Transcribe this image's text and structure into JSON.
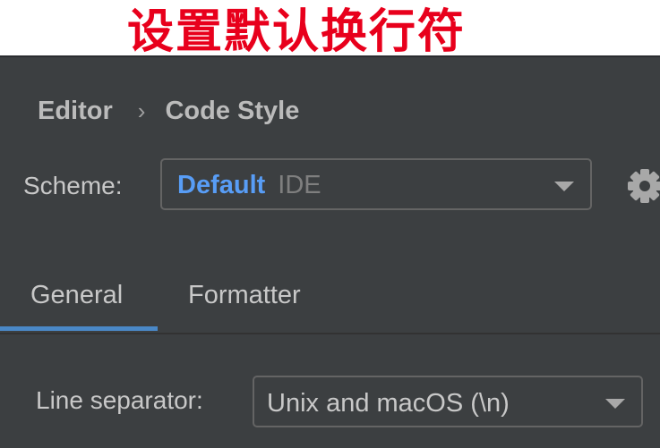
{
  "banner": {
    "title": "设置默认换行符"
  },
  "breadcrumb": {
    "items": [
      "Editor",
      "Code Style"
    ],
    "separator": "›"
  },
  "scheme": {
    "label": "Scheme:",
    "value_name": "Default",
    "value_type": "IDE",
    "settings_icon": "gear-icon"
  },
  "tabs": {
    "items": [
      "General",
      "Formatter"
    ],
    "selected": "General"
  },
  "line_separator": {
    "label": "Line separator:",
    "value": "Unix and macOS (\\n)"
  },
  "colors": {
    "background": "#3c3f41",
    "accent": "#589df6",
    "tab_underline": "#4a88c7",
    "banner_text": "#e8001c"
  }
}
